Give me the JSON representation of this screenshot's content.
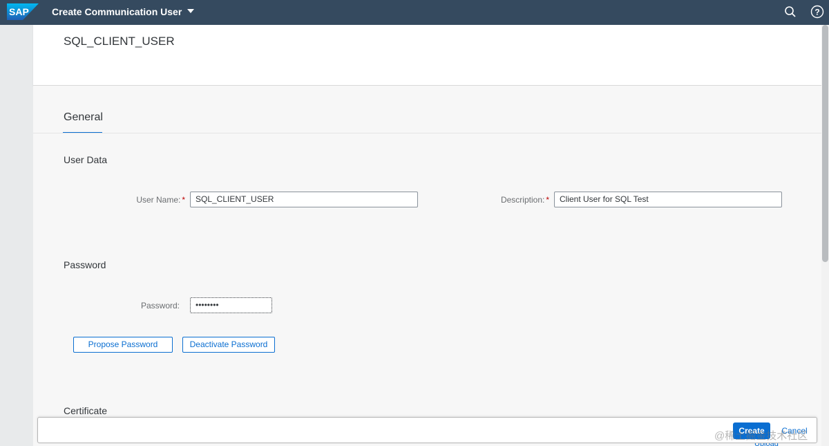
{
  "shell": {
    "logo_text": "SAP",
    "app_title": "Create Communication User",
    "search_icon": "search-icon",
    "help_icon": "help-icon"
  },
  "header": {
    "object_title": "SQL_CLIENT_USER"
  },
  "tabs": [
    {
      "label": "General",
      "selected": true
    }
  ],
  "user_data": {
    "section_title": "User Data",
    "user_name_label": "User Name:",
    "user_name_value": "SQL_CLIENT_USER",
    "description_label": "Description:",
    "description_value": "Client User for SQL Test",
    "required_marker": "*"
  },
  "password": {
    "section_title": "Password",
    "password_label": "Password:",
    "password_value": "••••••••",
    "propose_button": "Propose Password",
    "deactivate_button": "Deactivate Password"
  },
  "certificate": {
    "section_title": "Certificate",
    "upload_link": "Upload"
  },
  "footer": {
    "create_button": "Create",
    "cancel_button": "Cancel"
  },
  "watermark": "@稀土掘金技术社区",
  "colors": {
    "shell_bg": "#354a5f",
    "accent": "#0a6ed1",
    "required": "#bb0000"
  }
}
